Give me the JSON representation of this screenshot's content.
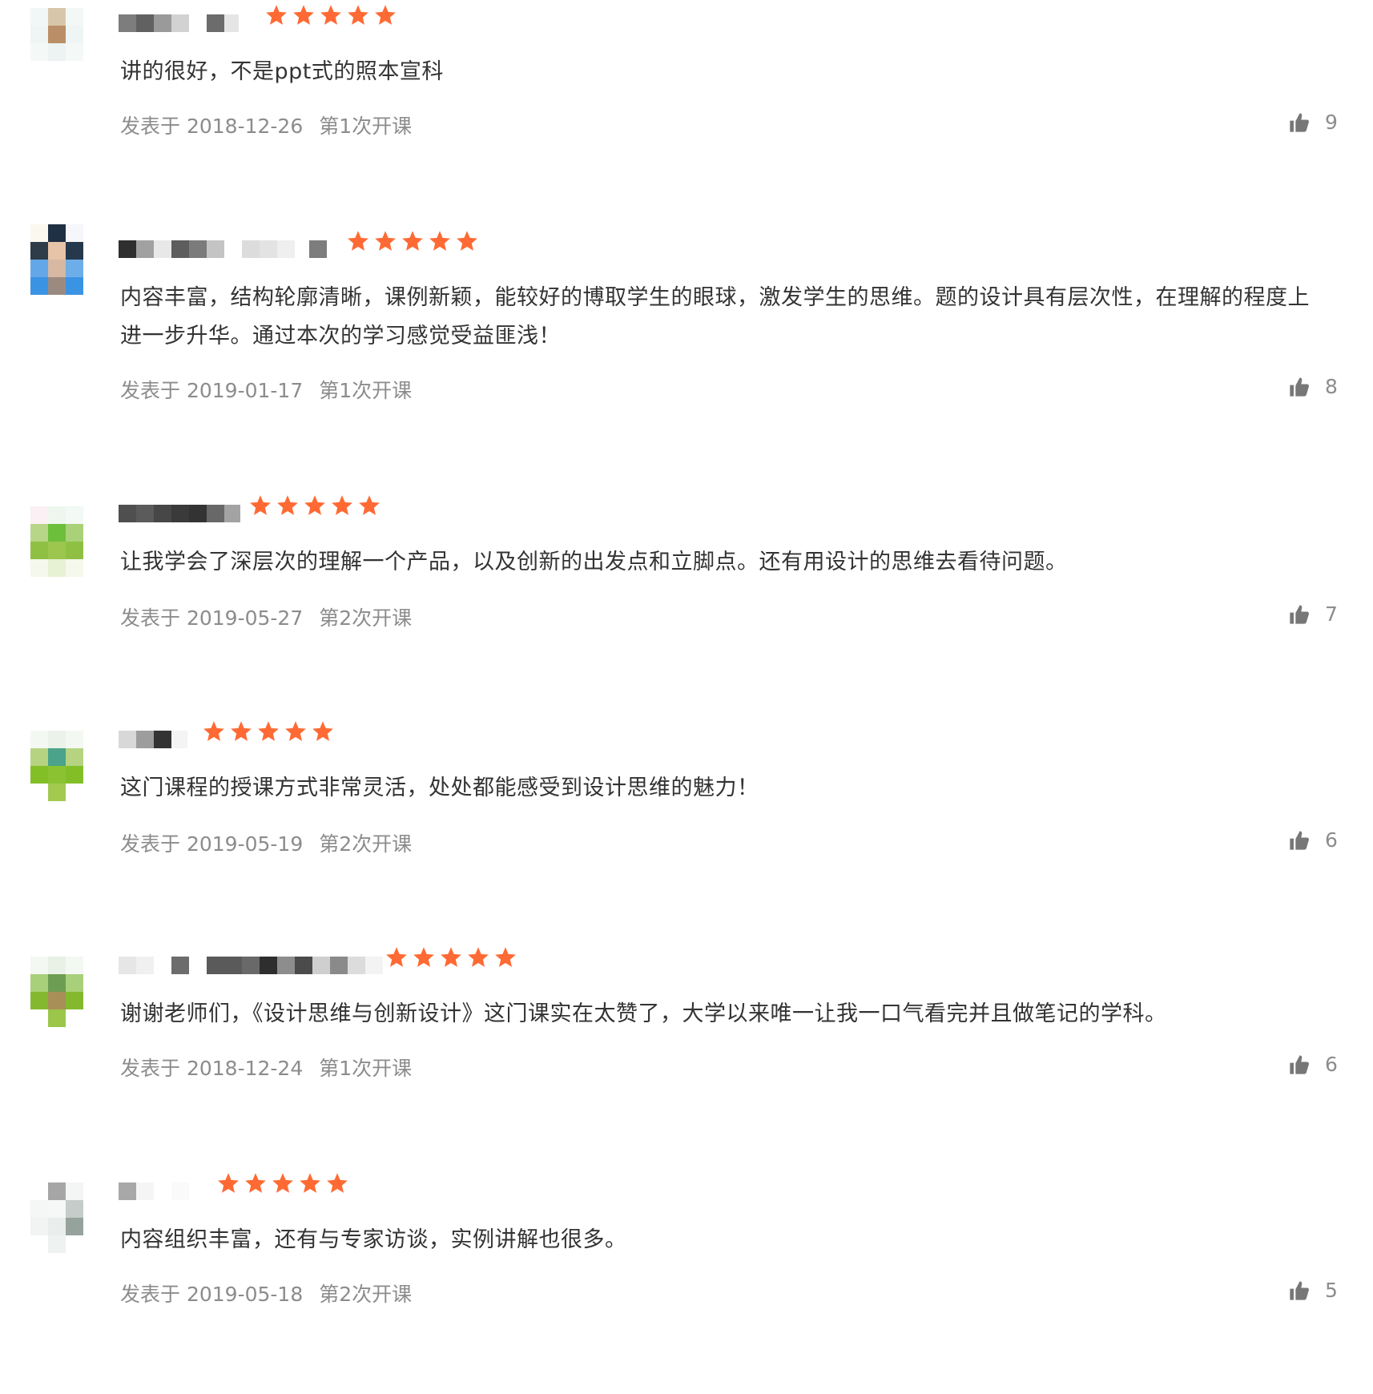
{
  "colors": {
    "star": "#ff6a34",
    "meta": "#8c8c8c",
    "text": "#333333",
    "like_icon": "#777777"
  },
  "icons": {
    "rating": "star-icon",
    "like": "thumbs-up-icon"
  },
  "reviews": [
    {
      "rating": 5,
      "content": "讲的很好，不是ppt式的照本宣科",
      "date": "发表于 2018-12-26",
      "term": "第1次开课",
      "likes": "9"
    },
    {
      "rating": 5,
      "content": "内容丰富，结构轮廓清晰，课例新颖，能较好的博取学生的眼球，激发学生的思维。题的设计具有层次性，在理解的程度上进一步升华。通过本次的学习感觉受益匪浅！",
      "date": "发表于 2019-01-17",
      "term": "第1次开课",
      "likes": "8"
    },
    {
      "rating": 5,
      "content": "让我学会了深层次的理解一个产品，以及创新的出发点和立脚点。还有用设计的思维去看待问题。",
      "date": "发表于 2019-05-27",
      "term": "第2次开课",
      "likes": "7"
    },
    {
      "rating": 5,
      "content": "这门课程的授课方式非常灵活，处处都能感受到设计思维的魅力！",
      "date": "发表于 2019-05-19",
      "term": "第2次开课",
      "likes": "6"
    },
    {
      "rating": 5,
      "content": "谢谢老师们，《设计思维与创新设计》这门课实在太赞了，大学以来唯一让我一口气看完并且做笔记的学科。",
      "date": "发表于 2018-12-24",
      "term": "第1次开课",
      "likes": "6"
    },
    {
      "rating": 5,
      "content": "内容组织丰富，还有与专家访谈，实例讲解也很多。",
      "date": "发表于 2019-05-18",
      "term": "第2次开课",
      "likes": "5"
    }
  ]
}
